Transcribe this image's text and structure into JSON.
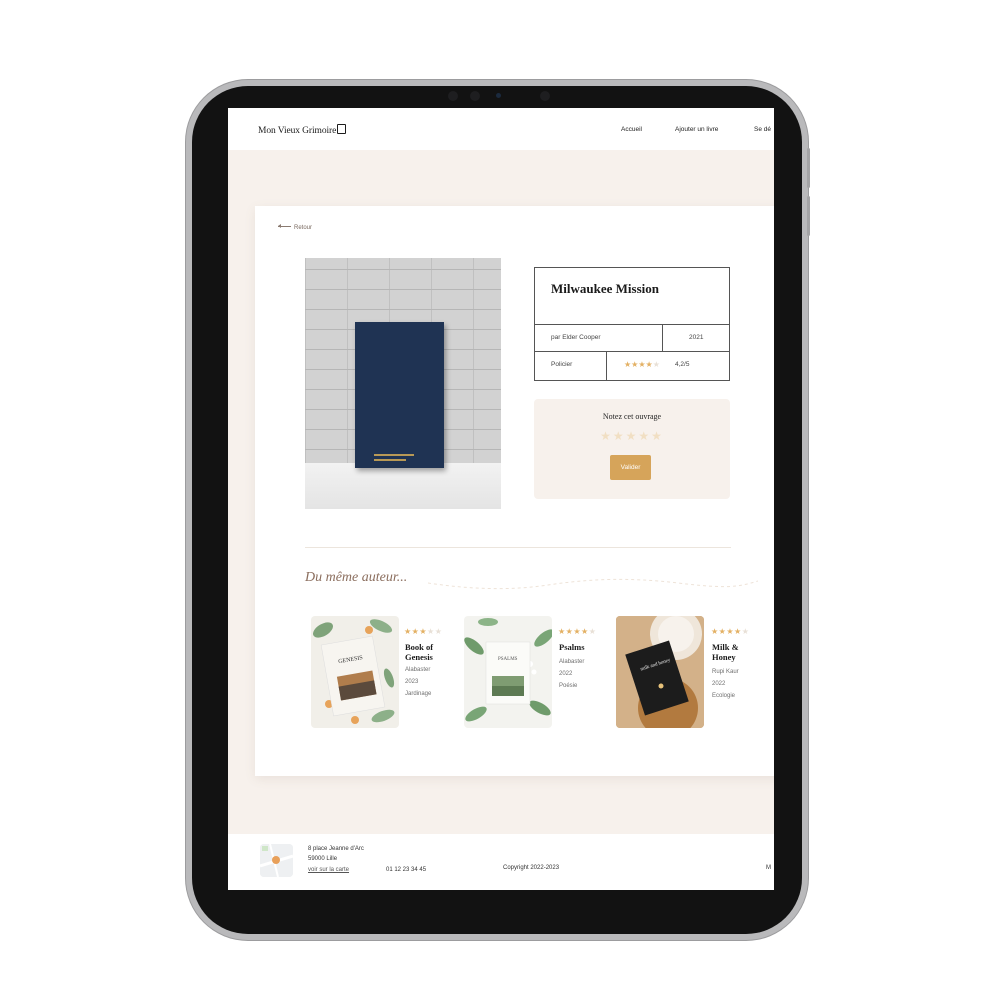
{
  "header": {
    "logo": "Mon Vieux Grimoire",
    "nav": [
      "Accueil",
      "Ajouter un livre",
      "Se dé"
    ]
  },
  "back_label": "Retour",
  "book": {
    "title": "Milwaukee Mission",
    "author": "par Elder Cooper",
    "year": "2021",
    "genre": "Policier",
    "rating": 4.2,
    "rating_text": "4,2/5"
  },
  "rate": {
    "title": "Notez cet ouvrage",
    "button": "Valider"
  },
  "section_title": "Du même auteur...",
  "related": [
    {
      "title": "Book of Genesis",
      "author": "Alabaster",
      "year": "2023",
      "genre": "Jardinage",
      "rating": 3,
      "cover_text": "GENESIS"
    },
    {
      "title": "Psalms",
      "author": "Alabaster",
      "year": "2022",
      "genre": "Poésie",
      "rating": 4,
      "cover_text": "PSALMS"
    },
    {
      "title": "Milk & Honey",
      "author": "Rupi Kaur",
      "year": "2022",
      "genre": "Ecologie",
      "rating": 4,
      "cover_text": "milk and honey"
    }
  ],
  "footer": {
    "address_line1": "8 place Jeanne d'Arc",
    "address_line2": "59000 Lille",
    "map_link": "voir sur la carte",
    "phone": "01 12 23 34 45",
    "copyright": "Copyright 2022-2023",
    "right_fragment": "M"
  },
  "colors": {
    "accent": "#d6a45a",
    "star": "#e3b063",
    "background": "#f7f1ec",
    "section_title": "#8b6e5e"
  }
}
